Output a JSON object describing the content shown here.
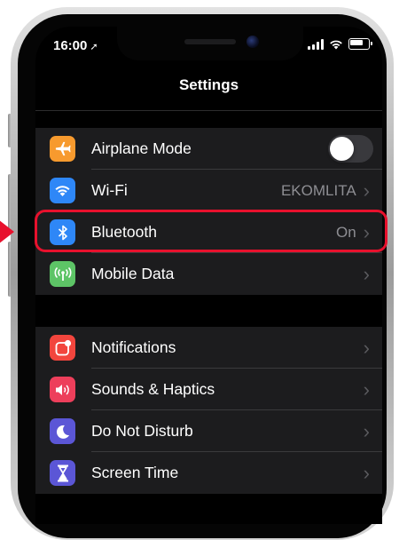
{
  "status_bar": {
    "time": "16:00"
  },
  "nav": {
    "title": "Settings"
  },
  "group1": [
    {
      "label": "Airplane Mode",
      "icon": "airplane-icon",
      "color": "#f79a2e",
      "toggle": "off"
    },
    {
      "label": "Wi-Fi",
      "icon": "wifi-icon",
      "color": "#2e87f7",
      "value": "EKOMLITA"
    },
    {
      "label": "Bluetooth",
      "icon": "bluetooth-icon",
      "color": "#2e87f7",
      "value": "On"
    },
    {
      "label": "Mobile Data",
      "icon": "antenna-icon",
      "color": "#5dc466"
    }
  ],
  "group2": [
    {
      "label": "Notifications",
      "icon": "notifications-icon",
      "color": "#f2453d"
    },
    {
      "label": "Sounds & Haptics",
      "icon": "speaker-icon",
      "color": "#ed3f5b"
    },
    {
      "label": "Do Not Disturb",
      "icon": "moon-icon",
      "color": "#5b56d6"
    },
    {
      "label": "Screen Time",
      "icon": "hourglass-icon",
      "color": "#5b56d6"
    }
  ],
  "highlight_color": "#e8112d"
}
